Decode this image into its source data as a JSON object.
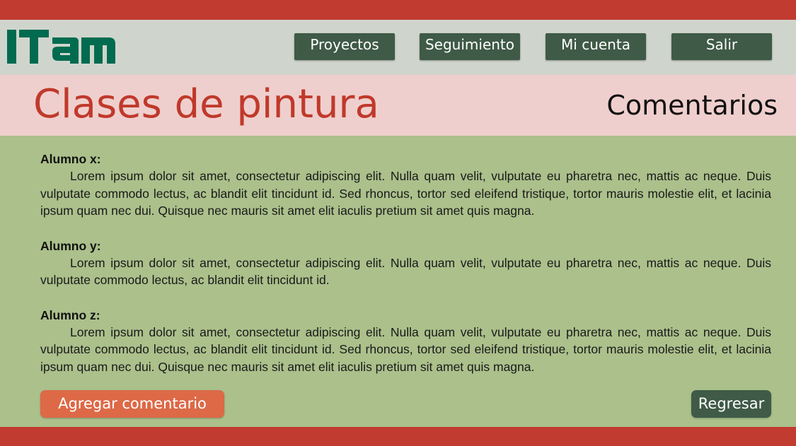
{
  "colors": {
    "brand_red": "#c13b30",
    "header_gray": "#cfd5cd",
    "title_band_pink": "#efcfcd",
    "content_green": "#abc08b",
    "nav_green": "#3f5a46",
    "add_orange": "#dd6947",
    "logo_green": "#006b4f"
  },
  "header": {
    "logo_alt": "ITAM",
    "logo_icon": "itam-logo",
    "nav": [
      {
        "label": "Proyectos"
      },
      {
        "label": "Seguimiento"
      },
      {
        "label": "Mi cuenta"
      },
      {
        "label": "Salir"
      }
    ]
  },
  "title_band": {
    "title": "Clases de pintura",
    "section": "Comentarios"
  },
  "comments": [
    {
      "author": "Alumno x:",
      "text": "Lorem ipsum dolor sit amet, consectetur adipiscing elit. Nulla quam velit, vulputate eu pharetra nec, mattis ac neque. Duis vulputate commodo lectus, ac blandit elit tincidunt id. Sed rhoncus, tortor sed eleifend tristique, tortor mauris molestie elit, et lacinia ipsum quam nec dui. Quisque nec mauris sit amet elit iaculis pretium sit amet quis magna."
    },
    {
      "author": "Alumno y:",
      "text": "Lorem ipsum dolor sit amet, consectetur adipiscing elit. Nulla quam velit, vulputate eu pharetra nec, mattis ac neque. Duis vulputate commodo lectus, ac blandit elit tincidunt id."
    },
    {
      "author": "Alumno z:",
      "text": "Lorem ipsum dolor sit amet, consectetur adipiscing elit. Nulla quam velit, vulputate eu pharetra nec, mattis ac neque. Duis vulputate commodo lectus, ac blandit elit tincidunt id. Sed rhoncus, tortor sed eleifend tristique, tortor mauris molestie elit, et lacinia ipsum quam nec dui. Quisque nec mauris sit amet elit iaculis pretium sit amet quis magna."
    }
  ],
  "actions": {
    "add_label": "Agregar comentario",
    "back_label": "Regresar"
  }
}
